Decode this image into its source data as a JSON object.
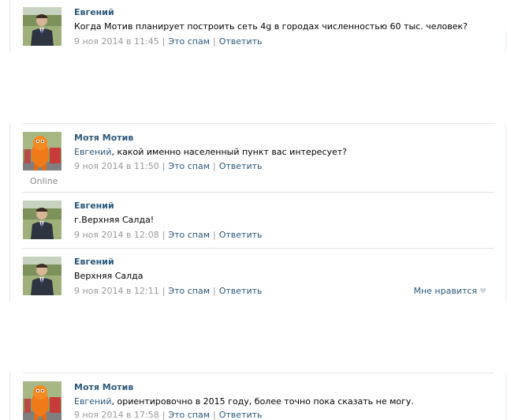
{
  "comments": [
    {
      "author": "Евгений",
      "text": "Когда Мотив планирует построить сеть 4g в городах численностью 60 тыс. человек?",
      "date": "9 ноя 2014 в 11:45",
      "spam_label": "Это спам",
      "reply_label": "Ответить"
    },
    {
      "author": "Мотя Мотив",
      "mention": "Евгений",
      "text": ", какой именно населенный пункт вас интересует?",
      "date": "9 ноя 2014 в 11:50",
      "spam_label": "Это спам",
      "reply_label": "Ответить",
      "status": "Online"
    },
    {
      "author": "Евгений",
      "text": "г.Верхняя Салда!",
      "date": "9 ноя 2014 в 12:08",
      "spam_label": "Это спам",
      "reply_label": "Ответить"
    },
    {
      "author": "Евгений",
      "text": "Верхняя Салда",
      "date": "9 ноя 2014 в 12:11",
      "spam_label": "Это спам",
      "reply_label": "Ответить",
      "like_label": "Мне нравится"
    },
    {
      "author": "Мотя Мотив",
      "mention": "Евгений",
      "text": ", ориентировочно в 2015 году, более точно пока сказать не могу.",
      "date": "9 ноя 2014 в 17:58",
      "spam_label": "Это спам",
      "reply_label": "Ответить"
    }
  ],
  "separator": "|",
  "colors": {
    "link": "#2b587a",
    "meta": "#999999",
    "rule": "#dfe3e7"
  }
}
